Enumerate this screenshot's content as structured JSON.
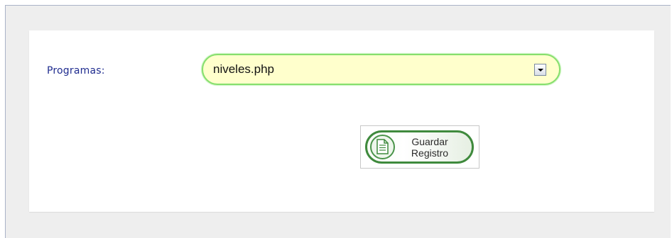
{
  "form": {
    "programs_label": "Programas",
    "programs_colon": ":",
    "programs_select": {
      "selected_value": "niveles.php"
    },
    "save_button": {
      "line1": "Guardar",
      "line2": "Registro"
    }
  },
  "colors": {
    "label_text": "#1f2c8f",
    "select_background": "#ffffcc",
    "select_border": "#86df6d",
    "button_border": "#3f8a3d"
  },
  "icons": {
    "save": "document-icon",
    "dropdown": "chevron-down-icon"
  }
}
